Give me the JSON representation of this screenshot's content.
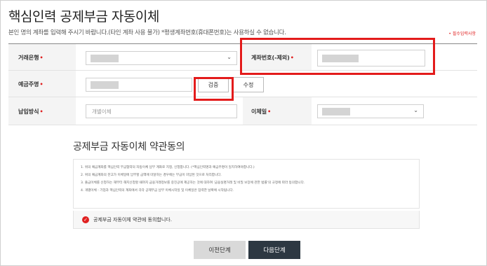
{
  "header": {
    "title": "핵심인력 공제부금 자동이체",
    "subtitle": "본인 명의 계좌를 입력해 주시기 바랍니다.(타인 계좌 사용 불가) *평생계좌번호(휴대폰번호)는 사용하실 수 없습니다.",
    "required_note": "• 필수입력사항"
  },
  "form": {
    "required_mark": "•",
    "bank": {
      "label": "거래은행"
    },
    "account": {
      "label": "계좌번호(-제외)"
    },
    "holder": {
      "label": "예금주명",
      "verify_button": "검증",
      "edit_button": "수정"
    },
    "payment_method": {
      "label": "납입방식",
      "placeholder": "개별이체"
    },
    "transfer_day": {
      "label": "이체일"
    }
  },
  "terms": {
    "title": "공제부금 자동이체 약관동의",
    "lines": [
      "1. 위의 예금계좌를 핵심인력 부금협약의 자동이체 납부 계좌로 지정, 신청합니다. (*핵심인력명과 예금주명이 일치하여야합니다.)",
      "2. 위의 예금계좌의 잔고가 이체일에 납부할 금액에 미달하는 경우에는 부금이 미납된 것으로 처리합니다.",
      "3. 출금이체를 신청하는 해부터 해지신청할 때까지 금융거래정보를 중진공에 제공하는 것에 대하여 '금융실명거래 및 비밀 보장에 관한 법률'의 규정에 따라 동의합니다.",
      "4. 개별이체 : 기업과 핵심인력의 계좌에서 각각 공제부금 납부 이체시작일 및 이체일은 입력한 날짜에 시작됩니다."
    ],
    "agree_label": "공제부금 자동이체 약관에 동의합니다.",
    "agreed_icon": "check-circle-icon"
  },
  "buttons": {
    "prev": "이전단계",
    "next": "다음단계"
  },
  "colors": {
    "required": "#e02020",
    "highlight_box": "#e31b1b",
    "next_button": "#2d3842",
    "prev_button": "#d9d9d9"
  }
}
